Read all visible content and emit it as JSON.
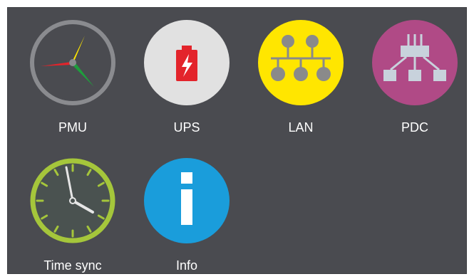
{
  "tiles": {
    "pmu": {
      "label": "PMU",
      "icon": "gauge-icon"
    },
    "ups": {
      "label": "UPS",
      "icon": "battery-charging-icon"
    },
    "lan": {
      "label": "LAN",
      "icon": "network-icon"
    },
    "pdc": {
      "label": "PDC",
      "icon": "data-concentrator-icon"
    },
    "time_sync": {
      "label": "Time sync",
      "icon": "clock-icon"
    },
    "info": {
      "label": "Info",
      "icon": "info-icon"
    }
  },
  "colors": {
    "panel_background": "#4a4b50",
    "label_text": "#ffffff",
    "ups_circle": "#e1e1e1",
    "ups_battery": "#e3242b",
    "lan_circle": "#ffe600",
    "lan_nodes": "#8a8a8a",
    "pdc_circle": "#b04a86",
    "pdc_blocks": "#c8d2dc",
    "time_ring": "#a5c63b",
    "info_circle": "#1a9ddb"
  }
}
